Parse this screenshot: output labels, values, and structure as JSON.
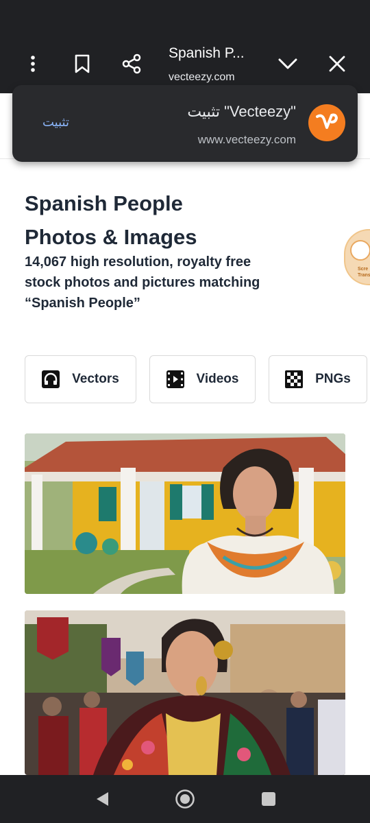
{
  "browser": {
    "tab_title": "Spanish P...",
    "url": "vecteezy.com"
  },
  "install_prompt": {
    "install_label": "تثبيت",
    "title": "تثبيت \"Vecteezy\"",
    "url": "www.vecteezy.com"
  },
  "page": {
    "title": "Spanish People Photos & Images",
    "subtitle": "14,067 high resolution, royalty free stock photos and pictures matching “Spanish People”"
  },
  "filter_chips": [
    {
      "label": "Vectors",
      "icon": "headphones-icon"
    },
    {
      "label": "Videos",
      "icon": "film-icon"
    },
    {
      "label": "PNGs",
      "icon": "checkerboard-icon"
    }
  ],
  "side_badge": {
    "text": "Scre Trans"
  },
  "photos": [
    {
      "icon": "woman-yellow-house-photo"
    },
    {
      "icon": "woman-festival-shawl-photo"
    }
  ],
  "colors": {
    "toolbar_bg": "#202124",
    "accent_orange": "#f47d20",
    "link_blue": "#8ab4f8"
  }
}
